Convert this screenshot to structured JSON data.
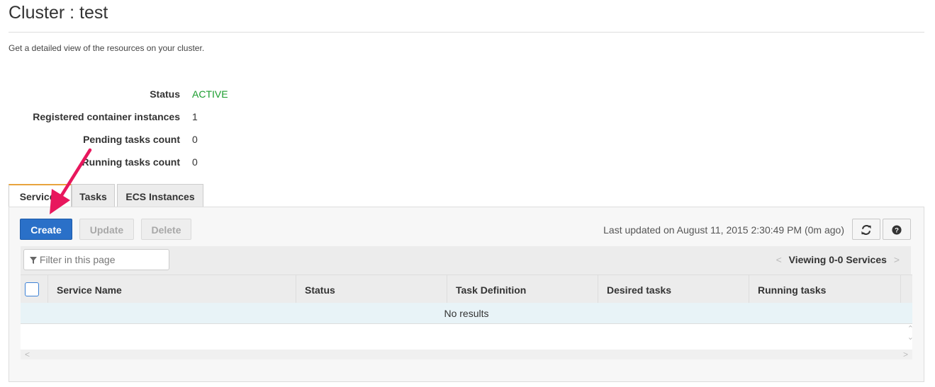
{
  "header": {
    "title": "Cluster : test",
    "subtitle": "Get a detailed view of the resources on your cluster."
  },
  "details": [
    {
      "label": "Status",
      "value": "ACTIVE"
    },
    {
      "label": "Registered container instances",
      "value": "1"
    },
    {
      "label": "Pending tasks count",
      "value": "0"
    },
    {
      "label": "Running tasks count",
      "value": "0"
    }
  ],
  "tabs": [
    {
      "label": "Services",
      "active": true
    },
    {
      "label": "Tasks"
    },
    {
      "label": "ECS Instances"
    }
  ],
  "toolbar": {
    "create_label": "Create",
    "update_label": "Update",
    "delete_label": "Delete",
    "last_updated": "Last updated on August 11, 2015 2:30:49 PM (0m ago)",
    "refresh_icon": "refresh-icon",
    "help_icon": "help-icon"
  },
  "filter": {
    "placeholder": "Filter in this page",
    "viewing": "Viewing 0-0 Services"
  },
  "table": {
    "columns": [
      "Service Name",
      "Status",
      "Task Definition",
      "Desired tasks",
      "Running tasks"
    ],
    "empty_message": "No results"
  },
  "colors": {
    "status_active": "#1a9c2e",
    "primary": "#2a70c8",
    "annotation_arrow": "#e8175d"
  }
}
